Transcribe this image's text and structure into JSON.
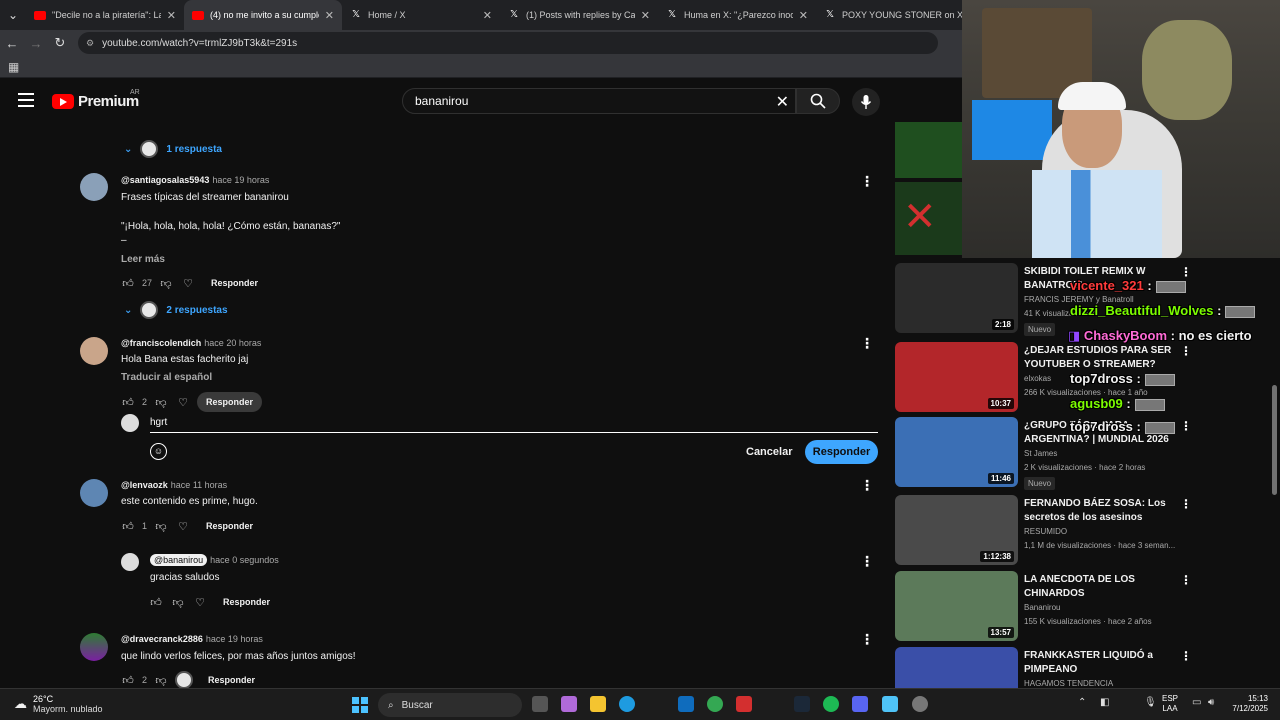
{
  "browser": {
    "tabs": [
      {
        "title": "\"Decile no a la piratería\": La ins",
        "icon": "youtube",
        "active": false
      },
      {
        "title": "(4) no me invito a su cumpleañ",
        "icon": "youtube",
        "active": true
      },
      {
        "title": "Home / X",
        "icon": "x",
        "active": false
      },
      {
        "title": "(1) Posts with replies by Carlos",
        "icon": "x",
        "active": false
      },
      {
        "title": "Huma en X: \"¿Parezco inocente",
        "icon": "x",
        "active": false
      },
      {
        "title": "POXY YOUNG STONER on X: \"",
        "icon": "x",
        "active": false
      }
    ],
    "url": "youtube.com/watch?v=trmlZJ9bT3k&t=291s"
  },
  "youtube": {
    "logo_word": "Premium",
    "country": "AR",
    "search_value": "bananirou"
  },
  "comments": {
    "top_toggle": "1 respuesta",
    "items": [
      {
        "author": "@santiagosalas5943",
        "time": "hace 19 horas",
        "lines": [
          "Frases típicas del streamer bananirou",
          "\"¡Hola, hola, hola, hola! ¿Cómo están, bananas?\"",
          "–"
        ],
        "read_more": "Leer más",
        "likes": "27",
        "reply_label": "Responder",
        "replies_toggle": "2 respuestas"
      },
      {
        "author": "@franciscolendich",
        "time": "hace 20 horas",
        "lines": [
          "Hola Bana estas facherito jaj"
        ],
        "translate": "Traducir al español",
        "likes": "2",
        "reply_label": "Responder"
      },
      {
        "author": "@lenvaozk",
        "time": "hace 11 horas",
        "lines": [
          "este contenido es prime, hugo."
        ],
        "likes": "1",
        "reply_label": "Responder"
      },
      {
        "author": "@bananirou",
        "time": "hace 0 segundos",
        "lines": [
          "gracias saludos"
        ],
        "likes": "",
        "reply_label": "Responder"
      },
      {
        "author": "@dravecranck2886",
        "time": "hace 19 horas",
        "lines": [
          "que lindo verlos felices, por mas años juntos amigos!"
        ],
        "likes": "2",
        "reply_label": "Responder"
      }
    ],
    "reply_box": {
      "value": "hgrt",
      "cancel": "Cancelar",
      "submit": "Responder"
    }
  },
  "sidebar": {
    "videos": [
      {
        "title": "SKIBIDI TOILET REMIX W BANATROLL",
        "channel": "FRANCIS JEREMY y Banatroll",
        "meta": "41 K visualizaciones",
        "badge": "Nuevo",
        "duration": "2:18",
        "thumb_color": "#2b2b2b"
      },
      {
        "title": "¿DEJAR ESTUDIOS PARA SER YOUTUBER O STREAMER?",
        "channel": "elxokas",
        "meta": "266 K visualizaciones · hace 1 año",
        "badge": "",
        "duration": "10:37",
        "thumb_color": "#b3262a"
      },
      {
        "title": "¿GRUPO FÁCIL PARA ARGENTINA? | MUNDIAL 2026",
        "channel": "St James",
        "meta": "2 K visualizaciones · hace 2 horas",
        "badge": "Nuevo",
        "duration": "11:46",
        "thumb_color": "#3b6fb5"
      },
      {
        "title": "FERNANDO BÁEZ SOSA: Los secretos de los asesinos",
        "channel": "RESUMIDO",
        "meta": "1,1 M de visualizaciones · hace 3 seman...",
        "badge": "",
        "duration": "1:12:38",
        "thumb_color": "#4a4a4a"
      },
      {
        "title": "LA ANECDOTA DE LOS CHINARDOS",
        "channel": "Bananirou",
        "meta": "155 K visualizaciones · hace 2 años",
        "badge": "",
        "duration": "13:57",
        "thumb_color": "#5c7a5a"
      },
      {
        "title": "FRANKKASTER LIQUIDÓ a PIMPEANO",
        "channel": "HAGAMOS TENDENCIA",
        "meta": "",
        "badge": "",
        "duration": "",
        "thumb_color": "#3a4fa8"
      }
    ]
  },
  "chat": [
    {
      "user": "vicente_321",
      "text": ":",
      "color": "#ff3b3b"
    },
    {
      "user": "dizzi_Beautiful_Wolves",
      "text": ":",
      "color": "#7cfc00"
    },
    {
      "user": "ChaskyBoom",
      "text": ": no es cierto",
      "color": "#ff6bd6"
    },
    {
      "user": "top7dross",
      "text": ":",
      "color": "#ffffff"
    },
    {
      "user": "agusb09",
      "text": ":",
      "color": "#7cfc00"
    },
    {
      "user": "top7dross",
      "text": ":",
      "color": "#ffffff"
    }
  ],
  "taskbar": {
    "temp": "26°C",
    "weather": "Mayorm. nublado",
    "search": "Buscar",
    "lang1": "ESP",
    "lang2": "LAA",
    "time": "15:13",
    "date": "7/12/2025"
  }
}
